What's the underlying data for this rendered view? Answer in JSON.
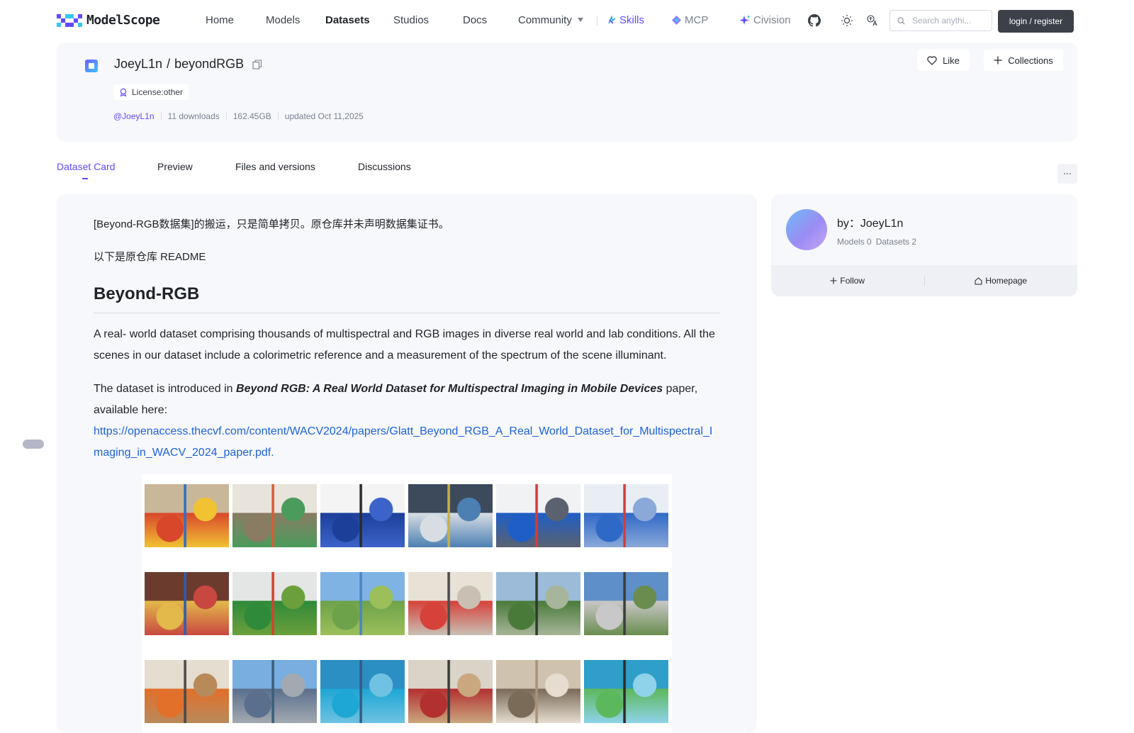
{
  "nav": {
    "logo_text": "ModelScope",
    "links": [
      "Home",
      "Models",
      "Datasets",
      "Studios",
      "Docs"
    ],
    "community_label": "Community",
    "skills_label": "Skills",
    "mcp_label": "MCP",
    "civision_label": "Civision",
    "search_placeholder": "Search anythi...",
    "login_label": "login / register",
    "accent_color": "#624aff"
  },
  "dataset": {
    "owner": "JoeyL1n",
    "separator": "/",
    "name": "beyondRGB",
    "license": "License:other",
    "owner_handle": "@JoeyL1n",
    "downloads": "11 downloads",
    "size": "162.45GB",
    "updated": "updated Oct 11,2025",
    "like_label": "Like",
    "collections_label": "Collections"
  },
  "tabs": [
    "Dataset Card",
    "Preview",
    "Files and versions",
    "Discussions"
  ],
  "readme": {
    "p1": "[Beyond-RGB数据集]的搬运，只是简单拷贝。原仓库并未声明数据集证书。",
    "p2": "以下是原仓库 README",
    "heading": "Beyond-RGB",
    "p3": "A real- world dataset comprising thousands of multispectral and RGB images in diverse real world and lab conditions. All the scenes in our dataset include a colorimetric reference and a measurement of the spectrum of the scene illuminant.",
    "p4_prefix": "The dataset is introduced in ",
    "p4_title": "Beyond RGB: A Real World Dataset for Multispectral Imaging in Mobile Devices",
    "p4_suffix": " paper, available here:",
    "p4_link": "https://openaccess.thecvf.com/content/WACV2024/papers/Glatt_Beyond_RGB_A_Real_World_Dataset_for_Multispectral_Imaging_in_WACV_2024_paper.pdf."
  },
  "author": {
    "by_label": "by：JoeyL1n",
    "models": "Models 0",
    "datasets": "Datasets 2",
    "follow_label": "Follow",
    "homepage_label": "Homepage"
  },
  "photos": [
    {
      "name": "photo-toys-shelf",
      "colors": [
        "#c9b79a",
        "#d9472b",
        "#2e6fc8",
        "#f1c232"
      ]
    },
    {
      "name": "photo-kitchen-counter",
      "colors": [
        "#e8e4dc",
        "#8a7b63",
        "#d85c3a",
        "#4a9b5c"
      ]
    },
    {
      "name": "photo-tripod-blue-rolls",
      "colors": [
        "#f4f4f4",
        "#1c3f9a",
        "#2b2b2b",
        "#3c63c9"
      ]
    },
    {
      "name": "photo-store-shelves",
      "colors": [
        "#3c4a5c",
        "#d7dde3",
        "#c7b04a",
        "#4c7fb2"
      ]
    },
    {
      "name": "photo-paper-rolls",
      "colors": [
        "#f1f2f4",
        "#1f5ec6",
        "#d43c3c",
        "#5a6270"
      ]
    },
    {
      "name": "photo-soft-packs",
      "colors": [
        "#e9eef5",
        "#2f69c8",
        "#d33d3d",
        "#8aa8d8"
      ]
    },
    {
      "name": "photo-cereal-shelf",
      "colors": [
        "#6b3c2e",
        "#e2b94a",
        "#2f5db0",
        "#c84840"
      ]
    },
    {
      "name": "photo-vegetables",
      "colors": [
        "#e3e6e4",
        "#2f8a3a",
        "#d0432f",
        "#6b9f3c"
      ]
    },
    {
      "name": "photo-park-lake",
      "colors": [
        "#7eb3e4",
        "#6da24a",
        "#4a84c4",
        "#9cbf5b"
      ]
    },
    {
      "name": "photo-speaker-room",
      "colors": [
        "#e8e1d6",
        "#d6413a",
        "#4b4b4b",
        "#c9c0b3"
      ]
    },
    {
      "name": "photo-fence-garden",
      "colors": [
        "#9bbbd9",
        "#4a7a3a",
        "#2d3a2d",
        "#a7b59a"
      ]
    },
    {
      "name": "photo-parking-cars",
      "colors": [
        "#5e8fc9",
        "#c8c8c8",
        "#3c3c3c",
        "#6a8d4f"
      ]
    },
    {
      "name": "photo-orange-pillows",
      "colors": [
        "#e5ddd0",
        "#e26f2a",
        "#4a4a4a",
        "#b88a5a"
      ]
    },
    {
      "name": "photo-river-dock",
      "colors": [
        "#78aee0",
        "#5a6f8c",
        "#3a5e7a",
        "#a3a9b1"
      ]
    },
    {
      "name": "photo-playground-blue",
      "colors": [
        "#2b8fc4",
        "#1ea6d4",
        "#385a83",
        "#6fc2e2"
      ]
    },
    {
      "name": "photo-person-room",
      "colors": [
        "#d9d3c8",
        "#b23030",
        "#3a3a3a",
        "#caa77f"
      ]
    },
    {
      "name": "photo-living-room-sofa",
      "colors": [
        "#cfc2ae",
        "#7a6a58",
        "#a89475",
        "#e6ddd0"
      ]
    },
    {
      "name": "photo-slide-tripod",
      "colors": [
        "#2f9ec9",
        "#5cb85c",
        "#2c2c2c",
        "#8fd3ea"
      ]
    }
  ]
}
